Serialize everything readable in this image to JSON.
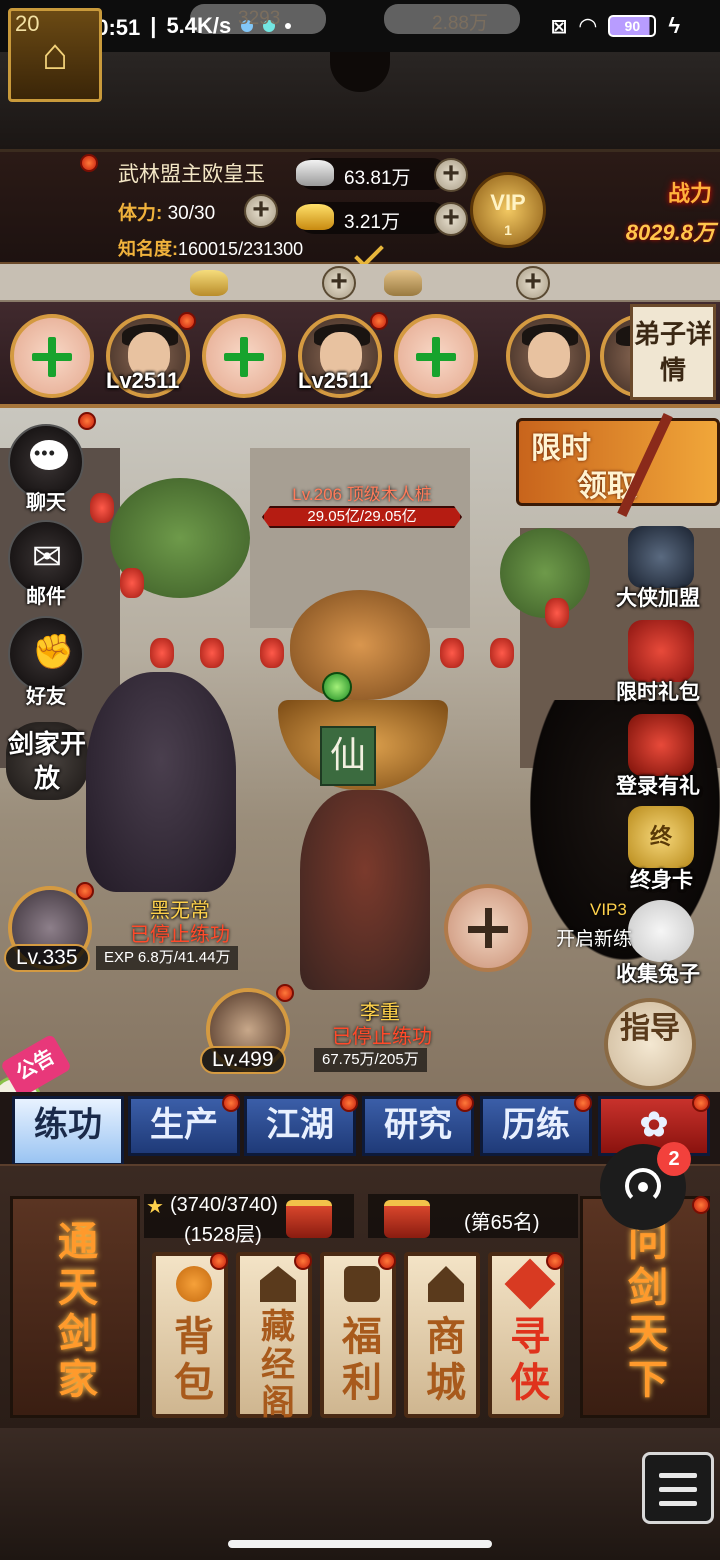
{
  "status_bar": {
    "time": "上午10:51",
    "speed": "5.4K/s",
    "battery": "90"
  },
  "player": {
    "level": "20",
    "name": "武林盟主欧皇玉",
    "stamina_label": "体力:",
    "stamina_value": "30/30",
    "fame_label": "知名度:",
    "fame_value": "160015/231300",
    "silver": "63.81万",
    "gold": "3.21万",
    "vip_label": "VIP",
    "vip_level": "1",
    "power_label": "战力",
    "power_value": "8029.8万"
  },
  "resources": {
    "ingot": "3293",
    "scroll": "2.88万"
  },
  "disciples": {
    "slots": [
      {
        "type": "add",
        "level": ""
      },
      {
        "type": "hero",
        "level": "Lv2511"
      },
      {
        "type": "add",
        "level": ""
      },
      {
        "type": "hero",
        "level": "Lv2511"
      },
      {
        "type": "add",
        "level": ""
      },
      {
        "type": "hero",
        "level": ""
      }
    ],
    "detail_button": "弟子详情"
  },
  "left_menu": {
    "chat": "聊天",
    "mail": "邮件",
    "friends": "好友",
    "sword_open": "剑家开放"
  },
  "promo_limited": {
    "line1": "限时",
    "line2": "领取"
  },
  "boss": {
    "title": "Lv.206 顶级木人桩",
    "hp": "29.05亿/29.05亿",
    "tag": "仙"
  },
  "right_menu": {
    "hero_join": "大侠加盟",
    "limited_gift": "限时礼包",
    "login_gift": "登录有礼",
    "lifetime_card": "终身卡",
    "lifetime_icon": "终",
    "collect_rabbit": "收集兔子"
  },
  "units": {
    "ninja": {
      "name": "黑无常",
      "status": "已停止练功",
      "level": "Lv.335",
      "exp": "EXP 6.8万/41.44万"
    },
    "soldier": {
      "name": "李重",
      "status": "已停止练功",
      "level": "Lv.499",
      "exp": "67.75万/205万"
    }
  },
  "vip_feature": {
    "vip": "VIP3",
    "text": "开启新练"
  },
  "guide_button": "指导",
  "notice_label": "公告",
  "tabs": [
    {
      "label": "练功",
      "active": true
    },
    {
      "label": "生产",
      "active": false
    },
    {
      "label": "江湖",
      "active": false
    },
    {
      "label": "研究",
      "active": false
    },
    {
      "label": "历练",
      "active": false
    }
  ],
  "tower": {
    "stars": "(3740/3740)",
    "floor": "(1528层)",
    "rank": "(第65名)"
  },
  "big_cards": {
    "left": "通天剑家",
    "right": "问剑天下"
  },
  "cards": [
    {
      "label": "背包"
    },
    {
      "label": "藏经阁"
    },
    {
      "label": "福利"
    },
    {
      "label": "商城"
    },
    {
      "label": "寻侠"
    }
  ],
  "float_badge": "2"
}
